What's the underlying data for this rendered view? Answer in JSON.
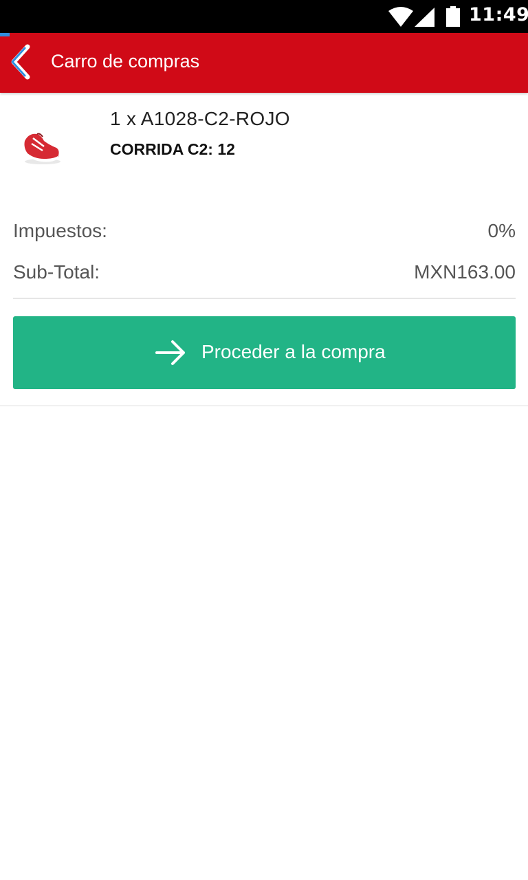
{
  "status_bar": {
    "time": "11:49",
    "icons": [
      "wifi-icon",
      "signal-icon",
      "battery-icon"
    ]
  },
  "app_bar": {
    "title": "Carro de compras",
    "back_icon": "back-chevron-icon",
    "color": "#d00a17"
  },
  "cart": {
    "items": [
      {
        "name": "1 x A1028-C2-ROJO",
        "variant": "CORRIDA C2: 12",
        "image_icon": "red-shoe-image"
      }
    ]
  },
  "summary": {
    "tax_label": "Impuestos:",
    "tax_value": "0%",
    "subtotal_label": "Sub-Total:",
    "subtotal_value": "MXN163.00"
  },
  "checkout": {
    "label": "Proceder a la compra",
    "icon": "arrow-right-icon",
    "color": "#22b486"
  }
}
